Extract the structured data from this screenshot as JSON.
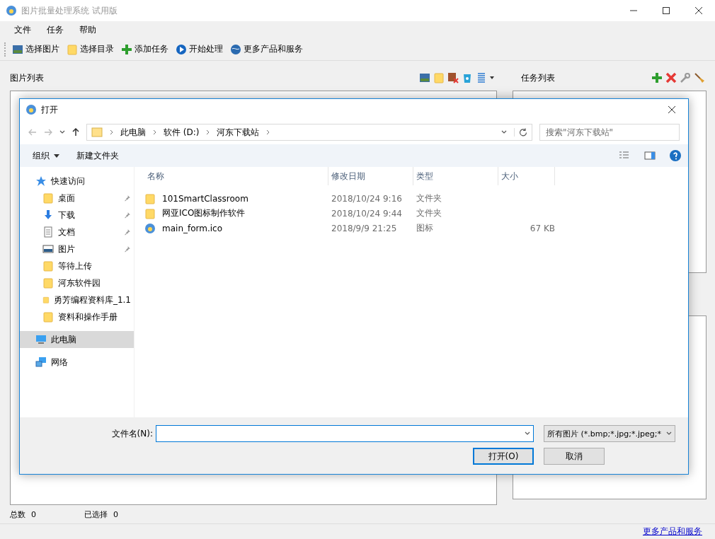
{
  "window": {
    "title": "图片批量处理系统 试用版"
  },
  "menu": [
    "文件",
    "任务",
    "帮助"
  ],
  "toolbar": [
    {
      "kind": "picture",
      "label": "选择图片"
    },
    {
      "kind": "folder",
      "label": "选择目录"
    },
    {
      "kind": "plus",
      "label": "添加任务"
    },
    {
      "kind": "play",
      "label": "开始处理"
    },
    {
      "kind": "globe",
      "label": "更多产品和服务"
    }
  ],
  "image_panel": {
    "title": "图片列表",
    "tools": [
      {
        "kind": "picture"
      },
      {
        "kind": "folder"
      },
      {
        "kind": "remove"
      },
      {
        "kind": "recycle"
      },
      {
        "kind": "list"
      }
    ]
  },
  "task_panel": {
    "title": "任务列表",
    "tools": [
      {
        "kind": "plus"
      },
      {
        "kind": "cross"
      },
      {
        "kind": "wrench"
      },
      {
        "kind": "broom"
      }
    ]
  },
  "status": [
    {
      "label": "总数",
      "value": "0"
    },
    {
      "label": "已选择",
      "value": "0"
    }
  ],
  "footer_link": "更多产品和服务",
  "dialog": {
    "title": "打开",
    "path": [
      "此电脑",
      "软件 (D:)",
      "河东下载站"
    ],
    "search": {
      "placeholder": "搜索\"河东下载站\""
    },
    "commands": [
      {
        "label": "组织",
        "dropdown": true
      },
      {
        "label": "新建文件夹",
        "dropdown": false
      }
    ],
    "nav": [
      {
        "kind": "star",
        "label": "快速访问",
        "pinned": false,
        "selected": false,
        "sub": false
      },
      {
        "kind": "folder",
        "label": "桌面",
        "pinned": true,
        "selected": false,
        "sub": true
      },
      {
        "kind": "download",
        "label": "下载",
        "pinned": true,
        "selected": false,
        "sub": true
      },
      {
        "kind": "doc",
        "label": "文档",
        "pinned": true,
        "selected": false,
        "sub": true
      },
      {
        "kind": "pictures",
        "label": "图片",
        "pinned": true,
        "selected": false,
        "sub": true
      },
      {
        "kind": "folder",
        "label": "等待上传",
        "pinned": false,
        "selected": false,
        "sub": true
      },
      {
        "kind": "folder",
        "label": "河东软件园",
        "pinned": false,
        "selected": false,
        "sub": true
      },
      {
        "kind": "folder",
        "label": "勇芳编程资料库_1.1",
        "pinned": false,
        "selected": false,
        "sub": true
      },
      {
        "kind": "folder",
        "label": "资料和操作手册",
        "pinned": false,
        "selected": false,
        "sub": true
      },
      {
        "kind": "pc",
        "label": "此电脑",
        "pinned": false,
        "selected": true,
        "sub": false
      },
      {
        "kind": "network",
        "label": "网络",
        "pinned": false,
        "selected": false,
        "sub": false
      }
    ],
    "columns": [
      "名称",
      "修改日期",
      "类型",
      "大小"
    ],
    "files": [
      {
        "kind": "folder",
        "name": "101SmartClassroom",
        "date": "2018/10/24 9:16",
        "type": "文件夹"
      },
      {
        "kind": "folder",
        "name": "网亚ICO图标制作软件",
        "date": "2018/10/24 9:44",
        "type": "文件夹"
      },
      {
        "kind": "icon",
        "name": "main_form.ico",
        "date": "2018/9/9 21:25",
        "type": "图标",
        "size": "67 KB"
      }
    ],
    "filename_label": "文件名(N):",
    "filter": "所有图片 (*.bmp;*.jpg;*.jpeg;*",
    "buttons": [
      {
        "label": "打开(O)",
        "default": true
      },
      {
        "label": "取消",
        "default": false
      }
    ]
  }
}
